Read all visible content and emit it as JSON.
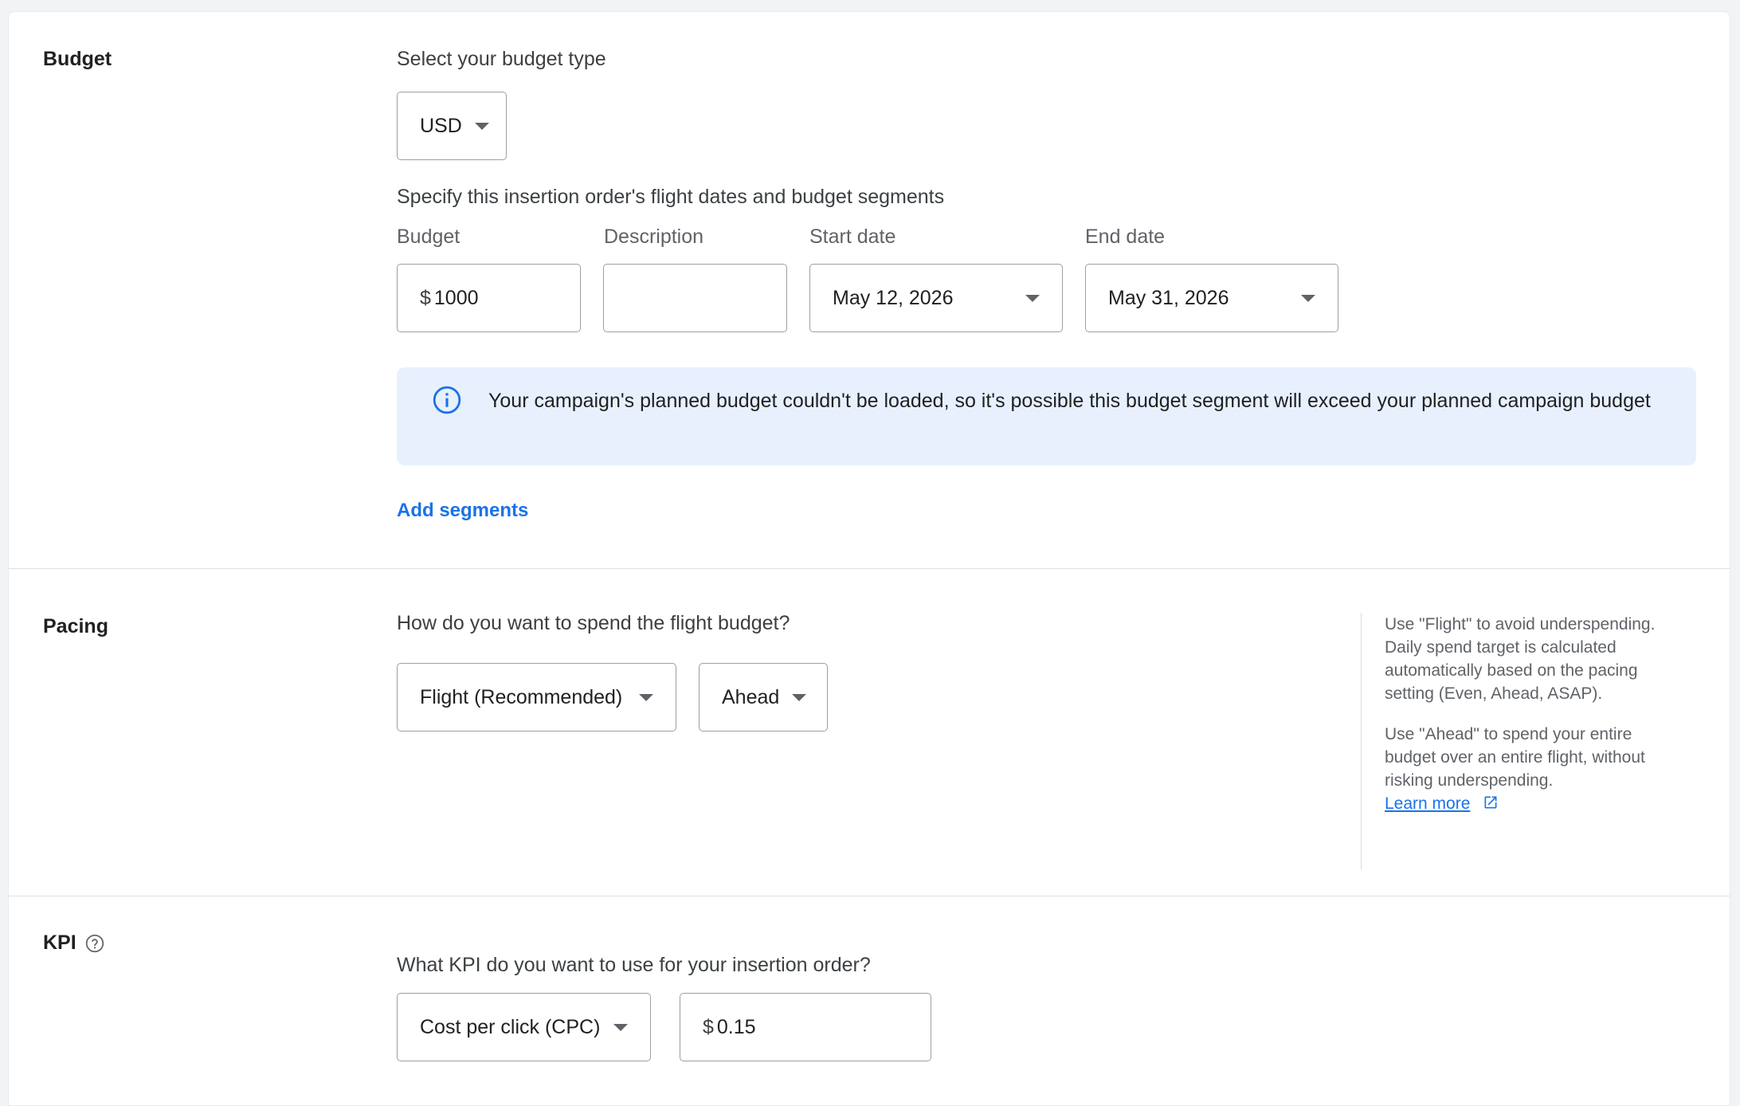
{
  "budget": {
    "title": "Budget",
    "type_prompt": "Select your budget type",
    "currency_select": "USD",
    "segments_prompt": "Specify this insertion order's flight dates and budget segments",
    "labels": {
      "budget": "Budget",
      "description": "Description",
      "start_date": "Start date",
      "end_date": "End date"
    },
    "segment": {
      "currency_symbol": "$",
      "amount": "1000",
      "description": "",
      "start_date": "May 12, 2026",
      "end_date": "May 31, 2026"
    },
    "info_message": "Your campaign's planned budget couldn't be loaded, so it's possible this budget segment will exceed your planned campaign budget",
    "add_segments": "Add segments"
  },
  "pacing": {
    "title": "Pacing",
    "prompt": "How do you want to spend the flight budget?",
    "period_select": "Flight (Recommended)",
    "rate_select": "Ahead",
    "help_para1": "Use \"Flight\" to avoid underspending. Daily spend target is calculated automatically based on the pacing setting (Even, Ahead, ASAP).",
    "help_para2": "Use \"Ahead\" to spend your entire budget over an entire flight, without risking underspending.",
    "learn_more": "Learn more"
  },
  "kpi": {
    "title": "KPI",
    "prompt": "What KPI do you want to use for your insertion order?",
    "kpi_select": "Cost per click (CPC)",
    "currency_symbol": "$",
    "value": "0.15"
  },
  "colors": {
    "link": "#1a73e8",
    "info_bg": "#e8f0fe",
    "border": "#9aa0a6"
  }
}
